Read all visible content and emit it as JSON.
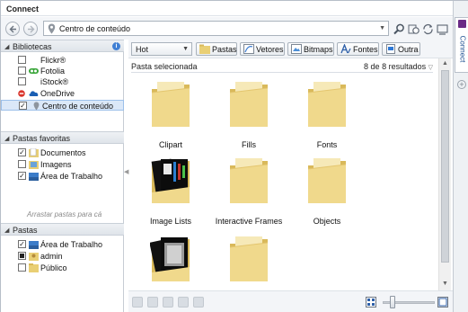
{
  "window": {
    "title": "Connect"
  },
  "address": {
    "text": "Centro de conteúdo"
  },
  "left": {
    "libraries_header": "Bibliotecas",
    "libraries": [
      {
        "label": "Flickr®",
        "checked": false,
        "icon": "flickr-icon"
      },
      {
        "label": "Fotolia",
        "checked": false,
        "icon": "fotolia-icon"
      },
      {
        "label": "iStock®",
        "checked": false,
        "icon": "istock-icon"
      },
      {
        "label": "OneDrive",
        "checked": false,
        "icon": "onedrive-icon"
      },
      {
        "label": "Centro de conteúdo",
        "checked": true,
        "icon": "location-icon"
      }
    ],
    "favorites_header": "Pastas favoritas",
    "favorites": [
      {
        "label": "Documentos",
        "checked": true
      },
      {
        "label": "Imagens",
        "checked": false
      },
      {
        "label": "Área de Trabalho",
        "checked": true
      }
    ],
    "favorites_hint": "Arrastar pastas para cá",
    "folders_header": "Pastas",
    "folders": [
      {
        "label": "Área de Trabalho",
        "checked": true
      },
      {
        "label": "admin",
        "checked": "partial"
      },
      {
        "label": "Público",
        "checked": false
      }
    ]
  },
  "toolbar": {
    "sort_value": "Hot",
    "buttons": {
      "pastas": "Pastas",
      "vetores": "Vetores",
      "bitmaps": "Bitmaps",
      "fontes": "Fontes",
      "outra": "Outra"
    }
  },
  "content": {
    "header_left": "Pasta selecionada",
    "header_right": "8 de 8 resultados",
    "items": [
      {
        "label": "Clipart",
        "kind": "folder"
      },
      {
        "label": "Fills",
        "kind": "folder"
      },
      {
        "label": "Fonts",
        "kind": "folder"
      },
      {
        "label": "Image Lists",
        "kind": "folder-with-preview"
      },
      {
        "label": "Interactive Frames",
        "kind": "folder"
      },
      {
        "label": "Objects",
        "kind": "folder"
      },
      {
        "label": "",
        "kind": "folder-with-preview"
      },
      {
        "label": "",
        "kind": "folder"
      }
    ]
  },
  "docker": {
    "tab_label": "Connect"
  },
  "colors": {
    "folder": "#f0d98c",
    "folder_dark": "#d9b95a",
    "accent": "#3f7fd4",
    "selection": "#dbe8f8"
  }
}
